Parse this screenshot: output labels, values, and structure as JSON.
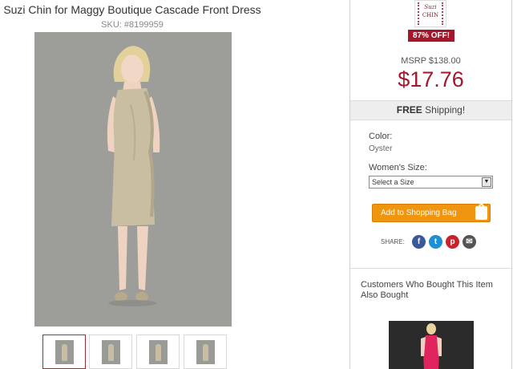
{
  "product": {
    "title": "Suzi Chin for Maggy Boutique Cascade Front Dress",
    "sku": "SKU: #8199959"
  },
  "thumbnails": {
    "count": 4,
    "selected_index": 0
  },
  "brand": {
    "logo_line1": "Suzi",
    "logo_line2": "CHIN"
  },
  "pricing": {
    "discount_badge": "87% OFF!",
    "msrp": "MSRP $138.00",
    "price": "$17.76",
    "accent_color": "#a5162b"
  },
  "shipping": {
    "bold": "FREE",
    "rest": " Shipping!"
  },
  "options": {
    "color_label": "Color:",
    "color_value": "Oyster",
    "size_label": "Women's Size:",
    "size_selected": "Select a Size"
  },
  "cart": {
    "add_label": "Add to Shopping Bag",
    "button_color": "#f0950f"
  },
  "share": {
    "label": "SHARE:",
    "icons": [
      "facebook-icon",
      "twitter-icon",
      "pinterest-icon",
      "email-icon"
    ]
  },
  "recommendations": {
    "title": "Customers Who Bought This Item Also Bought"
  }
}
